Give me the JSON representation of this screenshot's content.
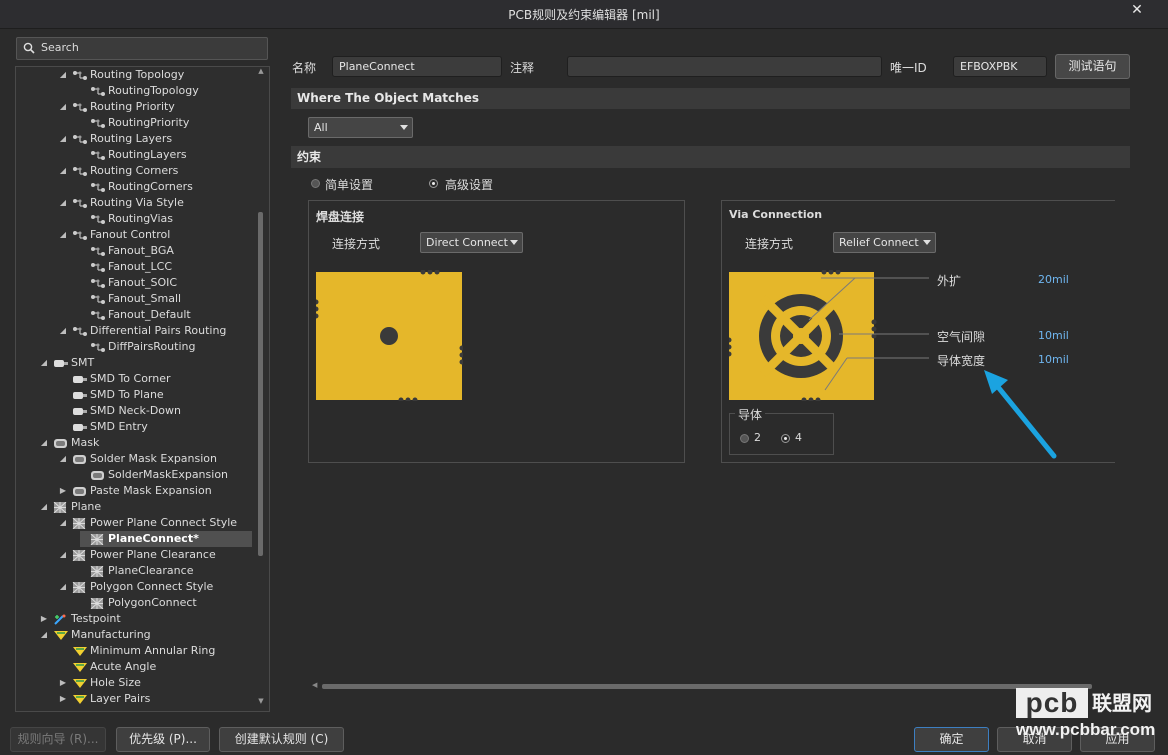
{
  "window": {
    "title": "PCB规则及约束编辑器 [mil]",
    "close_glyph": "✕"
  },
  "search": {
    "placeholder": "Search"
  },
  "tree": [
    {
      "label": "Routing Topology",
      "level": 1,
      "arrow": "down",
      "icon": "rule-category-icon"
    },
    {
      "label": "RoutingTopology",
      "level": 2,
      "arrow": "",
      "icon": "rule-icon"
    },
    {
      "label": "Routing Priority",
      "level": 1,
      "arrow": "down",
      "icon": "rule-category-icon"
    },
    {
      "label": "RoutingPriority",
      "level": 2,
      "arrow": "",
      "icon": "rule-icon"
    },
    {
      "label": "Routing Layers",
      "level": 1,
      "arrow": "down",
      "icon": "rule-category-icon"
    },
    {
      "label": "RoutingLayers",
      "level": 2,
      "arrow": "",
      "icon": "rule-icon"
    },
    {
      "label": "Routing Corners",
      "level": 1,
      "arrow": "down",
      "icon": "rule-category-icon"
    },
    {
      "label": "RoutingCorners",
      "level": 2,
      "arrow": "",
      "icon": "rule-icon"
    },
    {
      "label": "Routing Via Style",
      "level": 1,
      "arrow": "down",
      "icon": "rule-category-icon"
    },
    {
      "label": "RoutingVias",
      "level": 2,
      "arrow": "",
      "icon": "rule-icon"
    },
    {
      "label": "Fanout Control",
      "level": 1,
      "arrow": "down",
      "icon": "rule-category-icon"
    },
    {
      "label": "Fanout_BGA",
      "level": 2,
      "arrow": "",
      "icon": "rule-icon"
    },
    {
      "label": "Fanout_LCC",
      "level": 2,
      "arrow": "",
      "icon": "rule-icon"
    },
    {
      "label": "Fanout_SOIC",
      "level": 2,
      "arrow": "",
      "icon": "rule-icon"
    },
    {
      "label": "Fanout_Small",
      "level": 2,
      "arrow": "",
      "icon": "rule-icon"
    },
    {
      "label": "Fanout_Default",
      "level": 2,
      "arrow": "",
      "icon": "rule-icon"
    },
    {
      "label": "Differential Pairs Routing",
      "level": 1,
      "arrow": "down",
      "icon": "rule-category-icon"
    },
    {
      "label": "DiffPairsRouting",
      "level": 2,
      "arrow": "",
      "icon": "rule-icon"
    },
    {
      "label": "SMT",
      "level": 0,
      "arrow": "down",
      "icon": "smt-icon"
    },
    {
      "label": "SMD To Corner",
      "level": 1,
      "arrow": "",
      "icon": "smt-icon"
    },
    {
      "label": "SMD To Plane",
      "level": 1,
      "arrow": "",
      "icon": "smt-icon"
    },
    {
      "label": "SMD Neck-Down",
      "level": 1,
      "arrow": "",
      "icon": "smt-icon"
    },
    {
      "label": "SMD Entry",
      "level": 1,
      "arrow": "",
      "icon": "smt-icon"
    },
    {
      "label": "Mask",
      "level": 0,
      "arrow": "down",
      "icon": "mask-icon"
    },
    {
      "label": "Solder Mask Expansion",
      "level": 1,
      "arrow": "down",
      "icon": "mask-icon"
    },
    {
      "label": "SolderMaskExpansion",
      "level": 2,
      "arrow": "",
      "icon": "mask-icon"
    },
    {
      "label": "Paste Mask Expansion",
      "level": 1,
      "arrow": "right",
      "icon": "mask-icon"
    },
    {
      "label": "Plane",
      "level": 0,
      "arrow": "down",
      "icon": "plane-icon"
    },
    {
      "label": "Power Plane Connect Style",
      "level": 1,
      "arrow": "down",
      "icon": "plane-icon"
    },
    {
      "label": "PlaneConnect*",
      "level": 2,
      "arrow": "",
      "icon": "plane-icon",
      "selected": true
    },
    {
      "label": "Power Plane Clearance",
      "level": 1,
      "arrow": "down",
      "icon": "plane-icon"
    },
    {
      "label": "PlaneClearance",
      "level": 2,
      "arrow": "",
      "icon": "plane-icon"
    },
    {
      "label": "Polygon Connect Style",
      "level": 1,
      "arrow": "down",
      "icon": "plane-icon"
    },
    {
      "label": "PolygonConnect",
      "level": 2,
      "arrow": "",
      "icon": "plane-icon"
    },
    {
      "label": "Testpoint",
      "level": 0,
      "arrow": "right",
      "icon": "testpoint-icon"
    },
    {
      "label": "Manufacturing",
      "level": 0,
      "arrow": "down",
      "icon": "manufacturing-icon"
    },
    {
      "label": "Minimum Annular Ring",
      "level": 1,
      "arrow": "",
      "icon": "manufacturing-icon"
    },
    {
      "label": "Acute Angle",
      "level": 1,
      "arrow": "",
      "icon": "manufacturing-icon"
    },
    {
      "label": "Hole Size",
      "level": 1,
      "arrow": "right",
      "icon": "manufacturing-icon"
    },
    {
      "label": "Layer Pairs",
      "level": 1,
      "arrow": "right",
      "icon": "manufacturing-icon"
    }
  ],
  "rule": {
    "name_label": "名称",
    "name_value": "PlaneConnect",
    "comment_label": "注释",
    "comment_value": "",
    "id_label": "唯一ID",
    "id_value": "EFBOXPBK",
    "test_button": "测试语句"
  },
  "where": {
    "header": "Where The Object Matches",
    "scope": "All"
  },
  "constraints": {
    "header": "约束",
    "mode_simple": "简单设置",
    "mode_advanced": "高级设置",
    "selected_mode": "advanced"
  },
  "pad_connection": {
    "title": "焊盘连接",
    "style_label": "连接方式",
    "style_value": "Direct Connect"
  },
  "via_connection": {
    "title": "Via Connection",
    "style_label": "连接方式",
    "style_value": "Relief Connect",
    "expansion_label": "外扩",
    "expansion_value": "20mil",
    "air_gap_label": "空气间隙",
    "air_gap_value": "10mil",
    "conductor_width_label": "导体宽度",
    "conductor_width_value": "10mil",
    "conductors_label": "导体",
    "conductors_option_2": "2",
    "conductors_option_4": "4",
    "conductors_selected": 4
  },
  "buttons": {
    "rule_wizard": "规则向导 (R)...",
    "priority": "优先级 (P)...",
    "create_default": "创建默认规则 (C)",
    "ok": "确定",
    "cancel": "取消",
    "apply": "应用"
  },
  "watermark": {
    "logo": "pcb",
    "brand": "联盟网",
    "url": "www.pcbbar.com"
  },
  "colors": {
    "copper": "#e5b72a",
    "hole": "#3a3a3a",
    "arrow": "#1ba3e0",
    "value": "#6fb6f0",
    "background": "#2b2b2b"
  }
}
